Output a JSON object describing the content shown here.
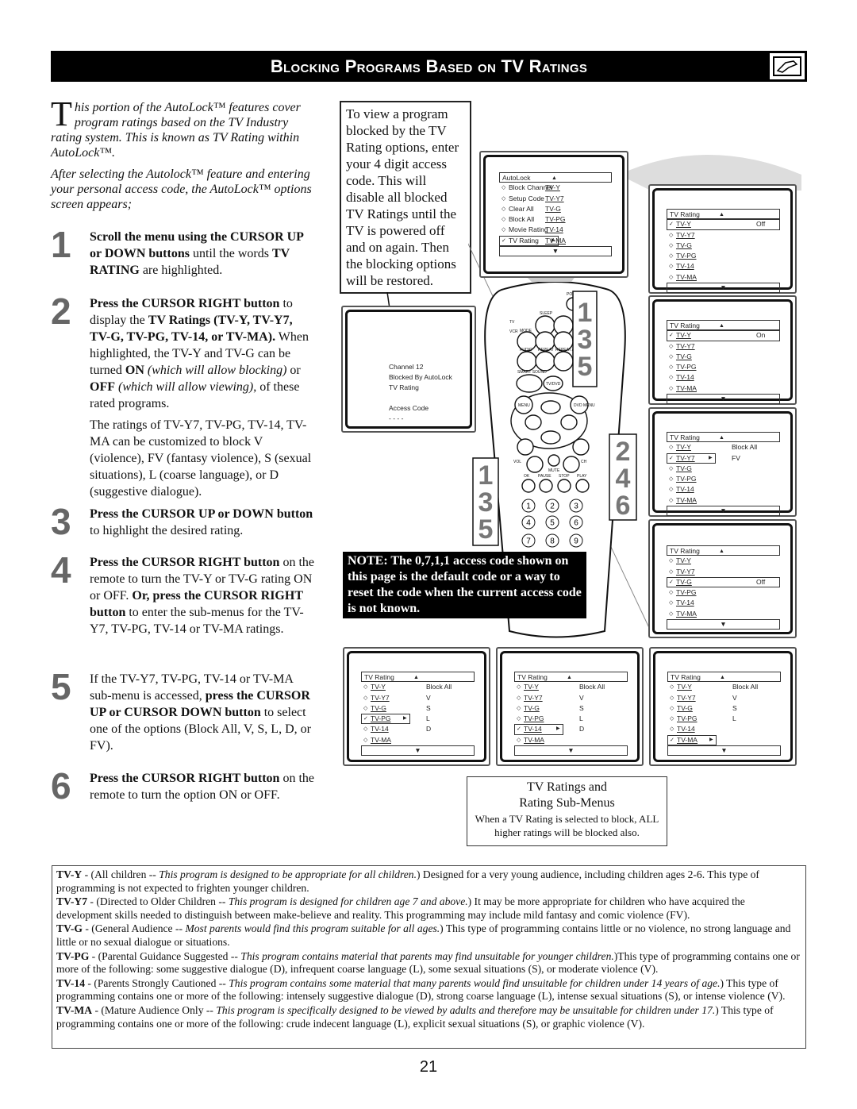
{
  "header": {
    "title": "Blocking Programs Based on TV Ratings",
    "icon": "remote-hand-icon"
  },
  "intro": {
    "drop": "T",
    "p1": "his portion of the AutoLock™ features cover program ratings based on the TV Industry rating system. This is known as TV Rating within AutoLock™.",
    "p2": "After selecting the Autolock™ feature and entering your personal access code, the AutoLock™ options screen appears;"
  },
  "steps": [
    {
      "num": "1",
      "segs": [
        {
          "t": "Scroll the menu using the CURSOR UP or DOWN buttons",
          "b": 1
        },
        {
          "t": " until the words "
        },
        {
          "t": "TV RATING",
          "b": 1
        },
        {
          "t": " are highlighted."
        }
      ]
    },
    {
      "num": "2",
      "segs": [
        {
          "t": "Press the CURSOR RIGHT button",
          "b": 1
        },
        {
          "t": " to display the "
        },
        {
          "t": "TV Ratings (TV-Y, TV-Y7, TV-G, TV-PG, TV-14, or TV-MA).",
          "b": 1
        },
        {
          "t": " When highlighted, the TV-Y and TV-G can be turned "
        },
        {
          "t": "ON",
          "b": 1
        },
        {
          "t": " (which will allow blocking)",
          "i": 1
        },
        {
          "t": " or "
        },
        {
          "t": "OFF",
          "b": 1
        },
        {
          "t": " (which will allow viewing)",
          "i": 1
        },
        {
          "t": ", of these rated programs."
        }
      ],
      "sub": "The ratings of TV-Y7, TV-PG, TV-14, TV-MA can be customized to block V (violence), FV (fantasy violence), S (sexual situations), L (coarse language), or D (suggestive dialogue)."
    },
    {
      "num": "3",
      "segs": [
        {
          "t": "Press the CURSOR UP or DOWN",
          "b": 1
        },
        {
          "t": " button",
          "b": 1
        },
        {
          "t": " to highlight the desired rating."
        }
      ]
    },
    {
      "num": "4",
      "segs": [
        {
          "t": "Press the CURSOR RIGHT button",
          "b": 1
        },
        {
          "t": " on the remote to turn the TV-Y or TV-G rating ON or OFF. "
        },
        {
          "t": "Or, press the CURSOR RIGHT button",
          "b": 1
        },
        {
          "t": " to enter the sub-menus for the TV-Y7, TV-PG, TV-14 or TV-MA ratings."
        }
      ]
    },
    {
      "num": "5",
      "segs": [
        {
          "t": "If the TV-Y7, TV-PG, TV-14 or TV-MA sub-menu is accessed, "
        },
        {
          "t": "press the CURSOR UP or CURSOR DOWN button",
          "b": 1
        },
        {
          "t": " to select one of the options (Block All, V, S, L, D, or FV)."
        }
      ]
    },
    {
      "num": "6",
      "segs": [
        {
          "t": "Press the CURSOR RIGHT button",
          "b": 1
        },
        {
          "t": " on the remote to turn the option ON or OFF."
        }
      ]
    }
  ],
  "view_note": "To view a program blocked by the TV Rating options, enter your 4 digit access code. This will disable all blocked TV Ratings until the TV is powered off and on again. Then the blocking options will be restored.",
  "blocked_screen": {
    "channel": "Channel 12",
    "blocked": "Blocked By AutoLock",
    "rating": "TV Rating",
    "access": "Access Code",
    "dashes": "- - - -"
  },
  "menus": [
    {
      "id": "autolock",
      "head": "AutoLock",
      "rows": [
        {
          "l": "Block Channel",
          "v": "TV-Y"
        },
        {
          "l": "Setup Code",
          "v": "TV-Y7"
        },
        {
          "l": "Clear All",
          "v": "TV-G"
        },
        {
          "l": "Block All",
          "v": "TV-PG"
        },
        {
          "l": "Movie Rating",
          "v": "TV-14"
        },
        {
          "l": "TV Rating",
          "v": "TV-MA",
          "sel": 1
        }
      ]
    },
    {
      "id": "r1",
      "head": "TV Rating",
      "rows": [
        {
          "l": "TV-Y",
          "v": "Off",
          "sel": 1,
          "wide": 1
        },
        {
          "l": "TV-Y7"
        },
        {
          "l": "TV-G"
        },
        {
          "l": "TV-PG"
        },
        {
          "l": "TV-14"
        },
        {
          "l": "TV-MA"
        }
      ]
    },
    {
      "id": "r2",
      "head": "TV Rating",
      "rows": [
        {
          "l": "TV-Y",
          "v": "On",
          "sel": 1,
          "wide": 1
        },
        {
          "l": "TV-Y7"
        },
        {
          "l": "TV-G"
        },
        {
          "l": "TV-PG"
        },
        {
          "l": "TV-14"
        },
        {
          "l": "TV-MA"
        }
      ]
    },
    {
      "id": "r3",
      "head": "TV Rating",
      "rows": [
        {
          "l": "TV-Y",
          "v": "Block All"
        },
        {
          "l": "TV-Y7",
          "v": "FV",
          "sel": 1
        },
        {
          "l": "TV-G"
        },
        {
          "l": "TV-PG"
        },
        {
          "l": "TV-14"
        },
        {
          "l": "TV-MA"
        }
      ]
    },
    {
      "id": "r4",
      "head": "TV Rating",
      "rows": [
        {
          "l": "TV-Y"
        },
        {
          "l": "TV-Y7"
        },
        {
          "l": "TV-G",
          "v": "Off",
          "sel": 1,
          "wide": 1
        },
        {
          "l": "TV-PG"
        },
        {
          "l": "TV-14"
        },
        {
          "l": "TV-MA"
        }
      ]
    },
    {
      "id": "b1",
      "head": "TV Rating",
      "rows": [
        {
          "l": "TV-Y",
          "v": "Block All"
        },
        {
          "l": "TV-Y7",
          "v": "V"
        },
        {
          "l": "TV-G",
          "v": "S"
        },
        {
          "l": "TV-PG",
          "v": "L",
          "sel": 1
        },
        {
          "l": "TV-14",
          "v": "D"
        },
        {
          "l": "TV-MA"
        }
      ]
    },
    {
      "id": "b2",
      "head": "TV Rating",
      "rows": [
        {
          "l": "TV-Y",
          "v": "Block All"
        },
        {
          "l": "TV-Y7",
          "v": "V"
        },
        {
          "l": "TV-G",
          "v": "S"
        },
        {
          "l": "TV-PG",
          "v": "L"
        },
        {
          "l": "TV-14",
          "v": "D",
          "sel": 1
        },
        {
          "l": "TV-MA"
        }
      ]
    },
    {
      "id": "b3",
      "head": "TV Rating",
      "rows": [
        {
          "l": "TV-Y",
          "v": "Block All"
        },
        {
          "l": "TV-Y7",
          "v": "V"
        },
        {
          "l": "TV-G",
          "v": "S"
        },
        {
          "l": "TV-PG",
          "v": "L"
        },
        {
          "l": "TV-14"
        },
        {
          "l": "TV-MA",
          "sel": 1
        }
      ]
    }
  ],
  "remote": {
    "labels": {
      "power": "POWER",
      "sleep": "SLEEP",
      "tv": "TV",
      "vcr": "VCR",
      "mode": "MODE",
      "audio": "AUDIO",
      "repeat": "REPEAT",
      "repeat_ab": "REPEAT A-B",
      "smart_sound": "SMART SOUND",
      "tvdvd": "TV/DVD",
      "menu": "MENU",
      "dvd_menu": "DVD MENU",
      "vol": "VOL",
      "ch": "CH",
      "mute": "MUTE",
      "ok": "OK",
      "pause": "PAUSE",
      "stop": "STOP",
      "play": "PLAY"
    },
    "digits": [
      "1",
      "2",
      "3",
      "4",
      "5",
      "6",
      "7",
      "8",
      "9"
    ],
    "callout_left": [
      "1",
      "3",
      "5"
    ],
    "callout_top": [
      "1",
      "3",
      "5"
    ],
    "callout_right": [
      "2",
      "4",
      "6"
    ]
  },
  "note": "NOTE: The 0,7,1,1 access code shown on this page is the default code or a way to reset the code when the current access code is not known.",
  "caption": {
    "title1": "TV Ratings and",
    "title2": "Rating Sub-Menus",
    "body": "When a TV Rating is selected to block, ALL higher ratings will be blocked also."
  },
  "legend": [
    {
      "code": "TV-Y",
      "lead": " - (All children -- ",
      "italic": "This program is designed to be appropriate for all children.",
      "rest": ") Designed for a very young audience, including children ages 2-6. This type of programming is not expected to frighten younger children."
    },
    {
      "code": "TV-Y7",
      "lead": " - (Directed to Older Children -- ",
      "italic": "This program is designed for children age 7 and above.",
      "rest": ") It may be more appropriate for children who have acquired the development skills needed to distinguish between make-believe and reality. This programming may include mild fantasy and comic violence (FV)."
    },
    {
      "code": "TV-G",
      "lead": " - (General Audience -- ",
      "italic": "Most parents would find this program suitable for all ages.",
      "rest": ") This type of programming contains little or no violence, no strong language and little or no sexual dialogue or situations."
    },
    {
      "code": "TV-PG",
      "lead": " - (Parental Guidance Suggested -- ",
      "italic": "This program contains material that parents may find unsuitable for younger children.",
      "rest": ")This type of programming contains one or more of the following: some suggestive dialogue (D), infrequent coarse language (L), some sexual situations (S), or moderate violence (V)."
    },
    {
      "code": "TV-14",
      "lead": " - (Parents Strongly Cautioned -- ",
      "italic": "This program contains some material that many parents would find unsuitable for children under 14 years of age.",
      "rest": ") This type of programming contains one or more of the following: intensely suggestive dialogue (D), strong coarse language (L), intense sexual situations (S), or intense violence (V)."
    },
    {
      "code": "TV-MA",
      "lead": " - (Mature Audience Only -- ",
      "italic": "This program is specifically designed to be viewed by adults and therefore may be unsuitable for children under 17.",
      "rest": ") This type of programming contains one or more of the following: crude indecent language (L), explicit sexual situations (S), or graphic violence (V)."
    }
  ],
  "page_number": "21"
}
